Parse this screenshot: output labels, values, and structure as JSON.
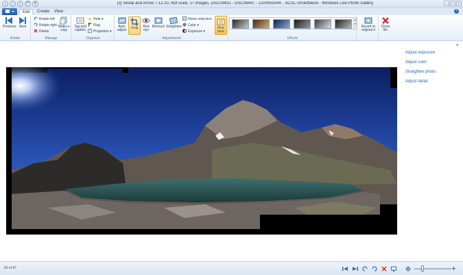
{
  "window": {
    "title": "[3] Vestal and Arrow 7.12.10, Not used, 17 images, DSC09431 - DSC09447 - 12009x5044 - SCUL-Smartblend - Windows Live Photo Gallery"
  },
  "qat": [
    "back-icon",
    "forward-icon",
    "save-icon",
    "undo-icon",
    "dropdown-icon"
  ],
  "tabs": [
    {
      "label": "Edit",
      "active": true
    },
    {
      "label": "Create",
      "active": false
    },
    {
      "label": "View",
      "active": false
    }
  ],
  "help": "?",
  "ribbon": {
    "rotate": {
      "label": "Rotate",
      "previous": "Previous",
      "next": "Next"
    },
    "manage": {
      "label": "Manage",
      "rotate_left": "Rotate left",
      "rotate_right": "Rotate right",
      "delete": "Delete",
      "make_copy": "Make a copy"
    },
    "organize": {
      "label": "Organize",
      "tag_caption": "Tag and caption",
      "rate": "Rate",
      "flag": "Flag",
      "properties": "Properties"
    },
    "adjustments": {
      "label": "Adjustments",
      "auto_adjust": "Auto adjust",
      "crop": "Crop",
      "red_eye": "Red eye",
      "retouch": "Retouch",
      "straighten": "Straighten",
      "noise_reduction": "Noise reduction",
      "color": "Color",
      "exposure": "Exposure",
      "fine_tune": "Fine tune"
    },
    "effects": {
      "label": "Effects"
    },
    "revert": "Revert to original",
    "close_file": "Close file"
  },
  "side_panel": {
    "close": "×",
    "items": [
      "Adjust exposure",
      "Adjust color",
      "Straighten photo",
      "Adjust detail"
    ]
  },
  "status": {
    "count": "80 of 87"
  },
  "colors": {
    "accent": "#2f6dbc",
    "fine_tune_bg": "#f6c657",
    "link": "#2266b4"
  }
}
